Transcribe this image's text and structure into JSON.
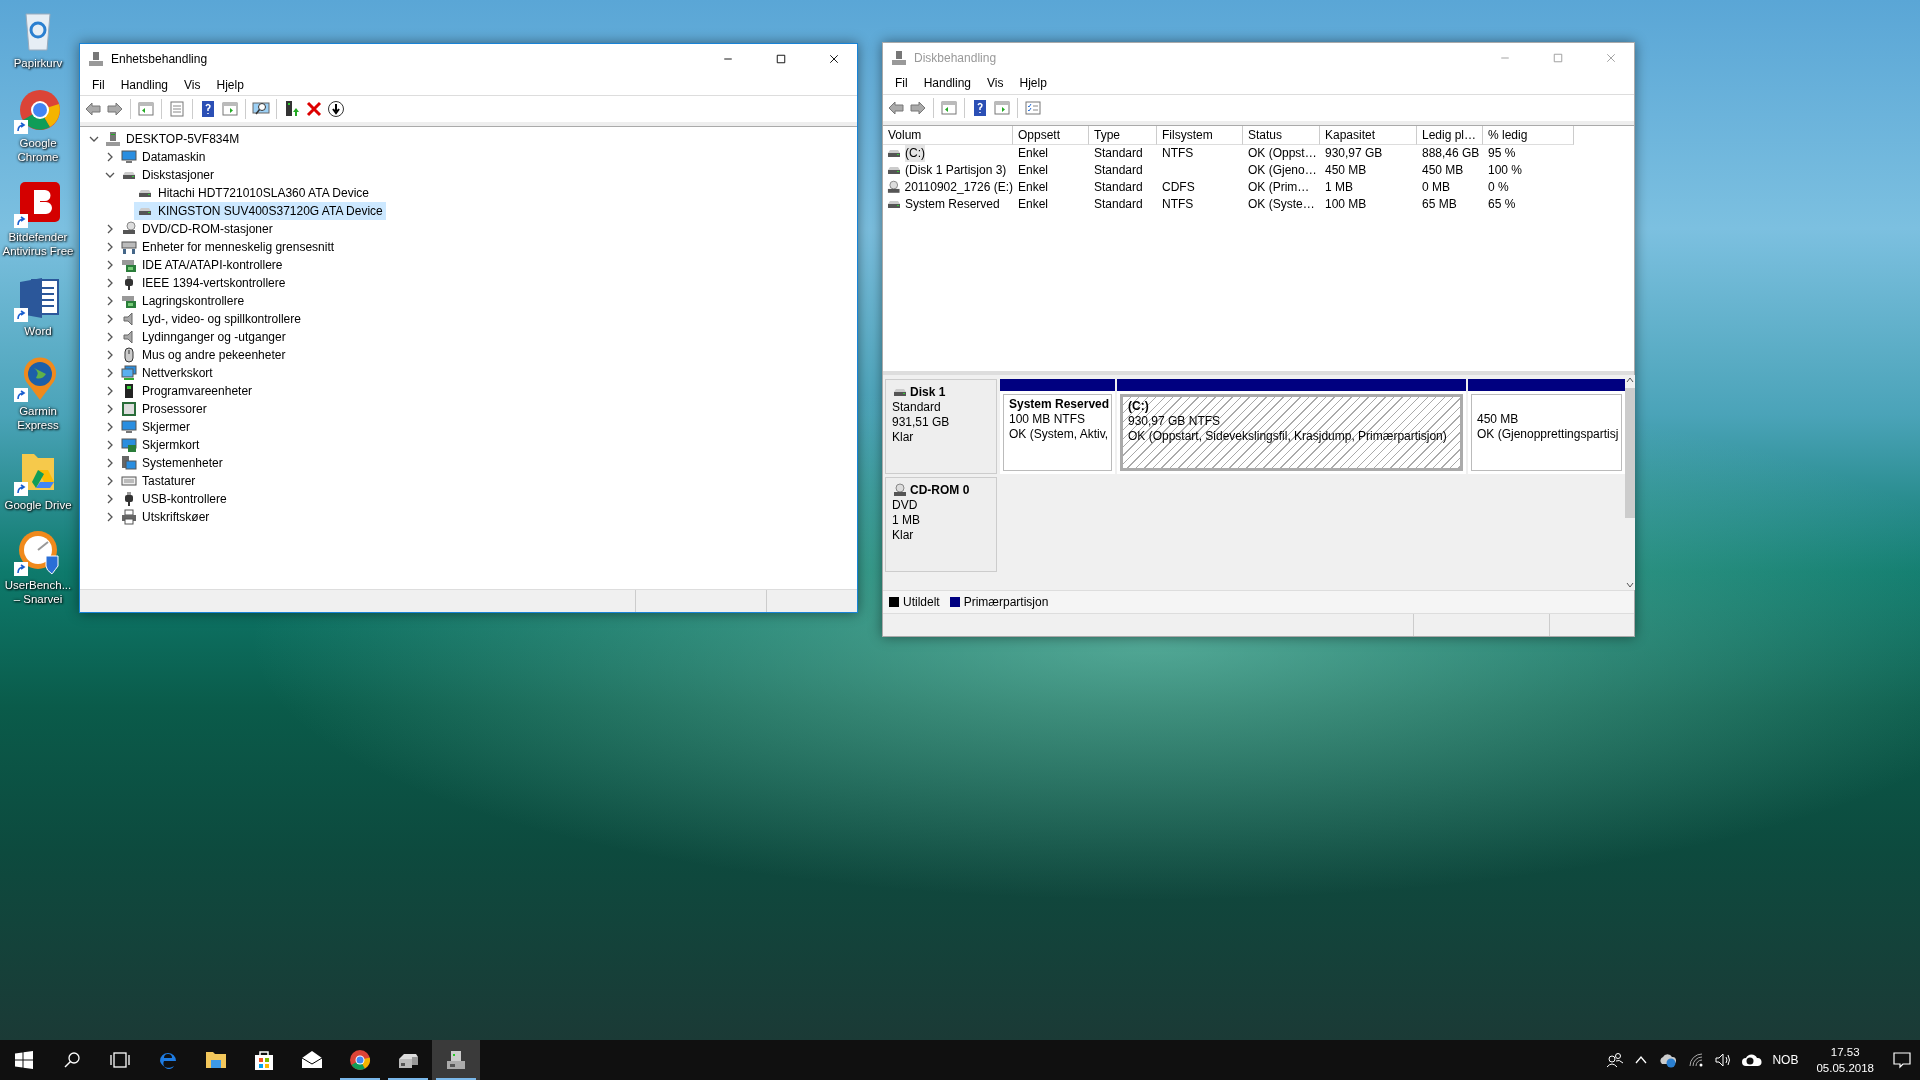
{
  "desktop_icons": [
    {
      "label": "Papirkurv",
      "kind": "recycle"
    },
    {
      "label": "Google Chrome",
      "kind": "chrome",
      "shortcut": true
    },
    {
      "label": "Bitdefender Antivirus Free",
      "kind": "bitdefender",
      "shortcut": true
    },
    {
      "label": "Word",
      "kind": "word",
      "shortcut": true
    },
    {
      "label": "Garmin Express",
      "kind": "garmin",
      "shortcut": true
    },
    {
      "label": "Google Drive",
      "kind": "drive",
      "shortcut": true
    },
    {
      "label": "UserBench... – Snarvei",
      "kind": "userbench",
      "shortcut": true
    }
  ],
  "device_manager": {
    "title": "Enhetsbehandling",
    "active": true,
    "menu": [
      "Fil",
      "Handling",
      "Vis",
      "Hjelp"
    ],
    "tree": {
      "label": "DESKTOP-5VF834M",
      "kind": "computer",
      "expanded": true,
      "selected": false,
      "children": [
        {
          "label": "Datamaskin",
          "kind": "monitor",
          "expanded": false,
          "selected": false
        },
        {
          "label": "Diskstasjoner",
          "kind": "disk",
          "expanded": true,
          "selected": false,
          "children": [
            {
              "label": "Hitachi HDT721010SLA360 ATA Device",
              "kind": "disk",
              "selected": false
            },
            {
              "label": "KINGSTON SUV400S37120G ATA Device",
              "kind": "disk",
              "selected": true
            }
          ]
        },
        {
          "label": "DVD/CD-ROM-stasjoner",
          "kind": "dvd",
          "expanded": false,
          "selected": false
        },
        {
          "label": "Enheter for menneskelig grensesnitt",
          "kind": "hid",
          "expanded": false,
          "selected": false
        },
        {
          "label": "IDE ATA/ATAPI-kontrollere",
          "kind": "controller",
          "expanded": false,
          "selected": false
        },
        {
          "label": "IEEE 1394-vertskontrollere",
          "kind": "plug",
          "expanded": false,
          "selected": false
        },
        {
          "label": "Lagringskontrollere",
          "kind": "controller",
          "expanded": false,
          "selected": false
        },
        {
          "label": "Lyd-, video- og spillkontrollere",
          "kind": "speaker",
          "expanded": false,
          "selected": false
        },
        {
          "label": "Lydinnganger og -utganger",
          "kind": "speaker",
          "expanded": false,
          "selected": false
        },
        {
          "label": "Mus og andre pekeenheter",
          "kind": "mouse",
          "expanded": false,
          "selected": false
        },
        {
          "label": "Nettverkskort",
          "kind": "network",
          "expanded": false,
          "selected": false
        },
        {
          "label": "Programvareenheter",
          "kind": "software",
          "expanded": false,
          "selected": false
        },
        {
          "label": "Prosessorer",
          "kind": "cpu",
          "expanded": false,
          "selected": false
        },
        {
          "label": "Skjermer",
          "kind": "monitor",
          "expanded": false,
          "selected": false
        },
        {
          "label": "Skjermkort",
          "kind": "displaycard",
          "expanded": false,
          "selected": false
        },
        {
          "label": "Systemenheter",
          "kind": "system",
          "expanded": false,
          "selected": false
        },
        {
          "label": "Tastaturer",
          "kind": "keyboard",
          "expanded": false,
          "selected": false
        },
        {
          "label": "USB-kontrollere",
          "kind": "plug",
          "expanded": false,
          "selected": false
        },
        {
          "label": "Utskriftskøer",
          "kind": "printer",
          "expanded": false,
          "selected": false
        }
      ]
    }
  },
  "disk_management": {
    "title": "Diskbehandling",
    "active": false,
    "menu": [
      "Fil",
      "Handling",
      "Vis",
      "Hjelp"
    ],
    "columns": [
      "Volum",
      "Oppsett",
      "Type",
      "Filsystem",
      "Status",
      "Kapasitet",
      "Ledig pl…",
      "% ledig"
    ],
    "rows": [
      {
        "kind": "disk",
        "selected": true,
        "cells": [
          "(C:)",
          "Enkel",
          "Standard",
          "NTFS",
          "OK (Oppst…",
          "930,97 GB",
          "888,46 GB",
          "95 %"
        ]
      },
      {
        "kind": "disk",
        "selected": false,
        "cells": [
          "(Disk 1 Partisjon 3)",
          "Enkel",
          "Standard",
          "",
          "OK (Gjeno…",
          "450 MB",
          "450 MB",
          "100 %"
        ]
      },
      {
        "kind": "cd",
        "selected": false,
        "cells": [
          "20110902_1726 (E:)",
          "Enkel",
          "Standard",
          "CDFS",
          "OK (Prim…",
          "1 MB",
          "0 MB",
          "0 %"
        ]
      },
      {
        "kind": "disk",
        "selected": false,
        "cells": [
          "System Reserved",
          "Enkel",
          "Standard",
          "NTFS",
          "OK (Syste…",
          "100 MB",
          "65 MB",
          "65 %"
        ]
      }
    ],
    "disks": [
      {
        "name": "Disk 1",
        "kind": "disk",
        "type": "Standard",
        "size": "931,51 GB",
        "state": "Klar",
        "partitions": [
          {
            "title": "System Reserved",
            "size": "100 MB NTFS",
            "status": "OK (System, Aktiv,",
            "kind": "primary",
            "selected": false
          },
          {
            "title": "(C:)",
            "size": "930,97 GB NTFS",
            "status": "OK (Oppstart, Sidevekslingsfil, Krasjdump, Primærpartisjon)",
            "kind": "primary",
            "selected": true
          },
          {
            "size": "450 MB",
            "status": "OK (Gjenopprettingspartisj",
            "kind": "primary",
            "selected": false
          }
        ]
      },
      {
        "name": "CD-ROM 0",
        "kind": "cd",
        "type": "DVD",
        "size": "1 MB",
        "state": "Klar"
      }
    ],
    "legend": [
      {
        "label": "Utildelt",
        "kind": "unallocated",
        "color": "#000000"
      },
      {
        "label": "Primærpartisjon",
        "kind": "primary",
        "color": "#000080"
      }
    ]
  },
  "taskbar": {
    "apps": [
      {
        "kind": "edge",
        "running": false,
        "active": false
      },
      {
        "kind": "explorer",
        "running": false,
        "active": false
      },
      {
        "kind": "store",
        "running": false,
        "active": false
      },
      {
        "kind": "mail",
        "running": false,
        "active": false
      },
      {
        "kind": "chrome",
        "running": true,
        "active": false
      },
      {
        "kind": "diskmgmt",
        "running": true,
        "active": false
      },
      {
        "kind": "devmgr",
        "running": true,
        "active": true
      }
    ],
    "language": "NOB",
    "time": "17.53",
    "date": "05.05.2018"
  }
}
